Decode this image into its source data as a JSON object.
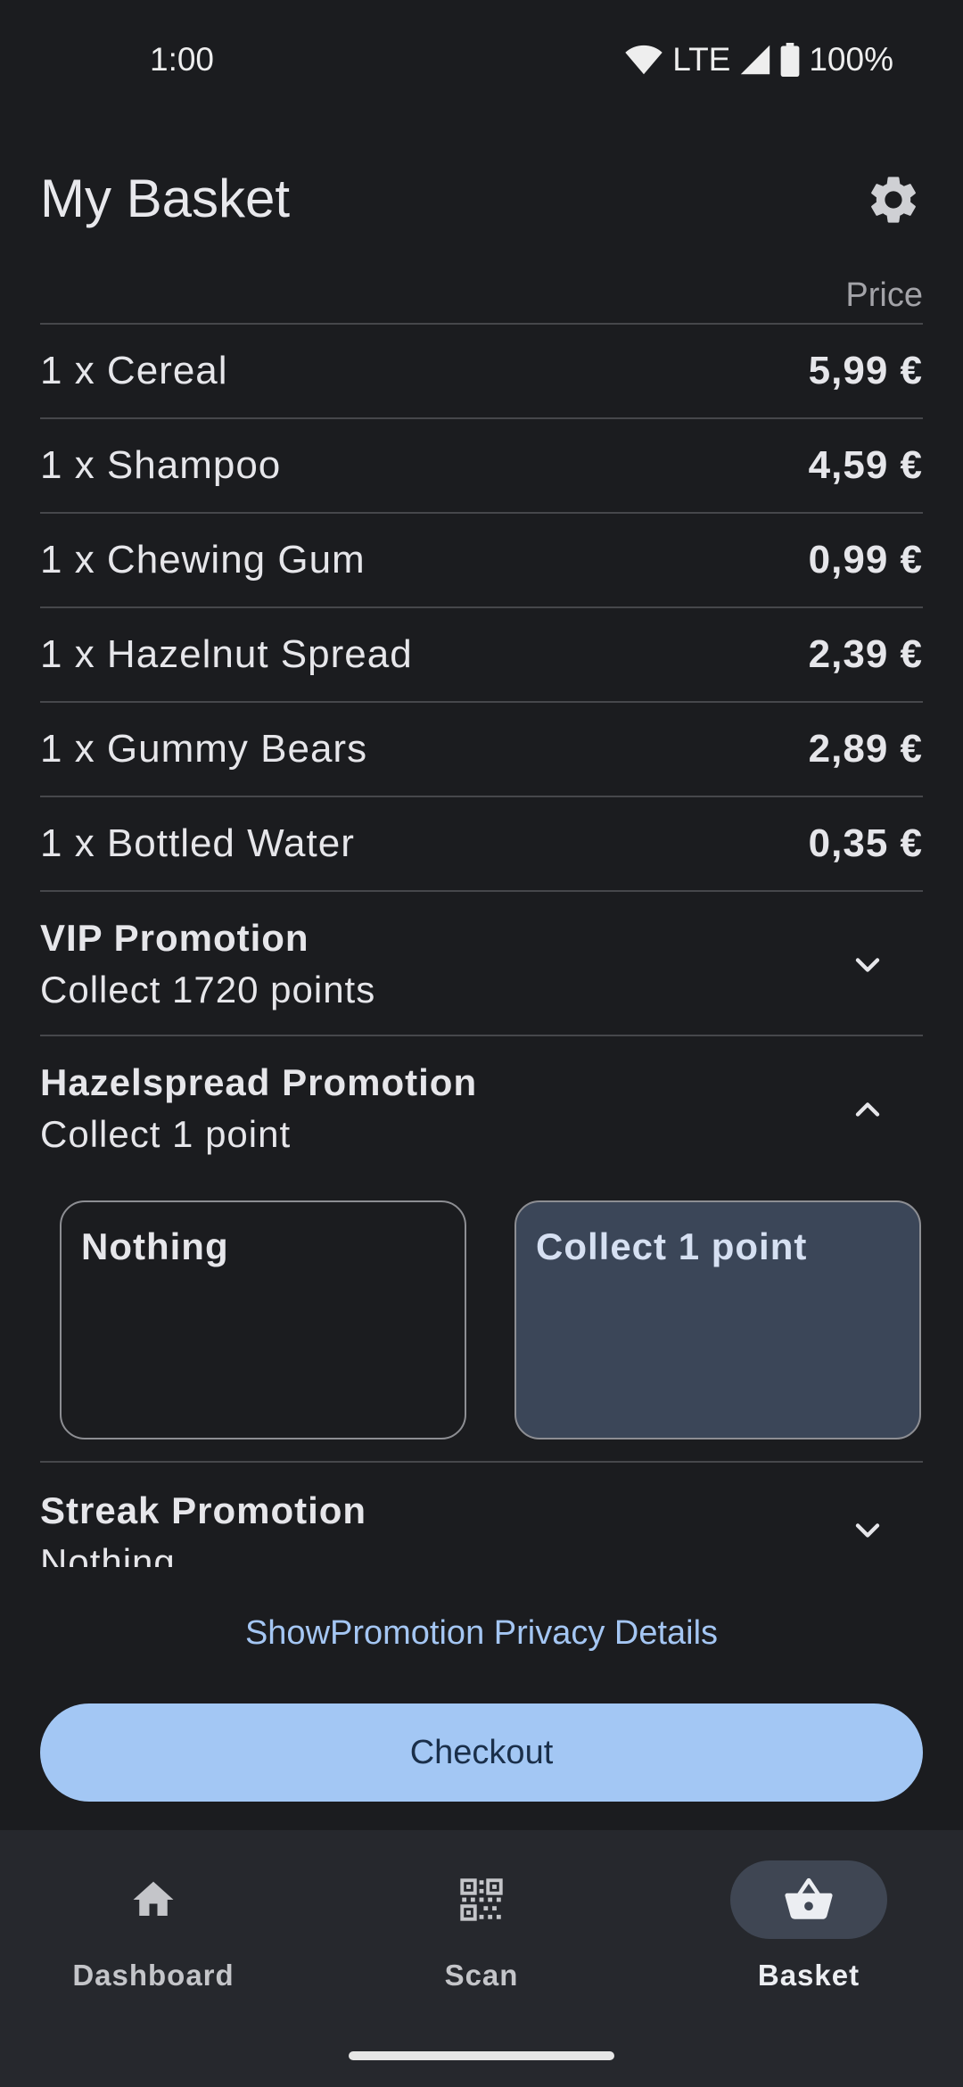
{
  "status_bar": {
    "time": "1:00",
    "network": "LTE",
    "battery": "100%"
  },
  "header": {
    "title": "My Basket",
    "settings_icon": "gear-icon"
  },
  "basket": {
    "price_header": "Price",
    "items": [
      {
        "label": "1 x Cereal",
        "price": "5,99 €"
      },
      {
        "label": "1 x Shampoo",
        "price": "4,59 €"
      },
      {
        "label": "1 x Chewing Gum",
        "price": "0,99 €"
      },
      {
        "label": "1 x Hazelnut Spread",
        "price": "2,39 €"
      },
      {
        "label": "1 x Gummy Bears",
        "price": "2,89 €"
      },
      {
        "label": "1 x Bottled Water",
        "price": "0,35 €"
      }
    ]
  },
  "promotions": [
    {
      "title": "VIP Promotion",
      "subtitle": "Collect 1720 points",
      "expanded": false
    },
    {
      "title": "Hazelspread Promotion",
      "subtitle": "Collect 1 point",
      "expanded": true,
      "options": [
        {
          "label": "Nothing",
          "selected": false
        },
        {
          "label": "Collect 1 point",
          "selected": true
        }
      ]
    },
    {
      "title": "Streak Promotion",
      "subtitle": "Nothing",
      "expanded": false
    }
  ],
  "privacy_link": "ShowPromotion Privacy Details",
  "checkout_label": "Checkout",
  "nav": [
    {
      "label": "Dashboard",
      "icon": "home-icon",
      "active": false
    },
    {
      "label": "Scan",
      "icon": "qr-code-icon",
      "active": false
    },
    {
      "label": "Basket",
      "icon": "basket-icon",
      "active": true
    }
  ],
  "colors": {
    "background": "#1b1c1f",
    "accent": "#a3c7f4",
    "selected_card": "#3b4658"
  }
}
